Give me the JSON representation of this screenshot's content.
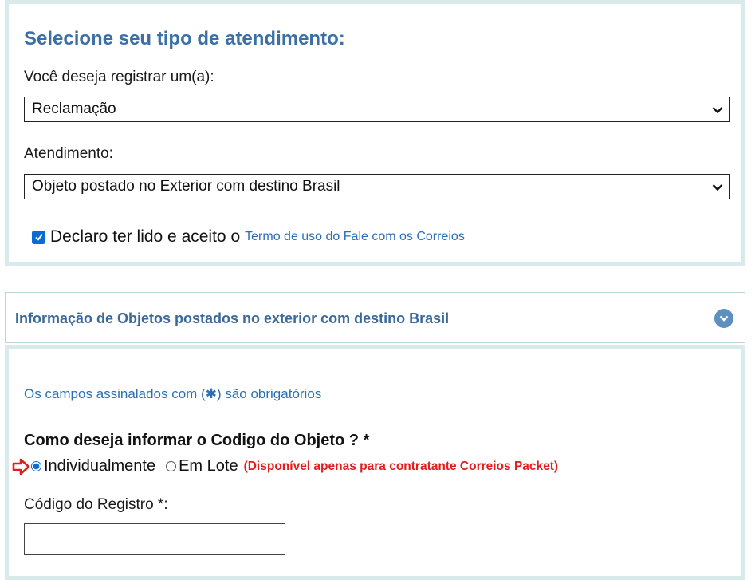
{
  "section1": {
    "title": "Selecione seu tipo de atendimento:",
    "register_label": "Você deseja registrar um(a):",
    "register_value": "Reclamação",
    "service_label": "Atendimento:",
    "service_value": "Objeto postado no Exterior com destino Brasil",
    "terms_checked": true,
    "terms_text": "Declaro ter lido e aceito o",
    "terms_link": "Termo de uso do Fale com os Correios"
  },
  "accordion": {
    "title": "Informação de Objetos postados no exterior com destino Brasil",
    "icon": "chevron-down-circle-icon"
  },
  "section2": {
    "required_note": "Os campos assinalados com (✱) são obrigatórios",
    "question": "Como deseja informar o Codigo do Objeto ? *",
    "options": [
      {
        "label": "Individualmente",
        "selected": true
      },
      {
        "label": "Em Lote",
        "selected": false
      }
    ],
    "availability_note": "(Disponível apenas para contratante Correios Packet)",
    "code_label": "Código do Registro *:",
    "code_value": ""
  },
  "colors": {
    "title_blue": "#3b70a7",
    "link_blue": "#2d6fb4",
    "warning_red": "#e11d1d",
    "panel_border": "#d8ebea"
  }
}
